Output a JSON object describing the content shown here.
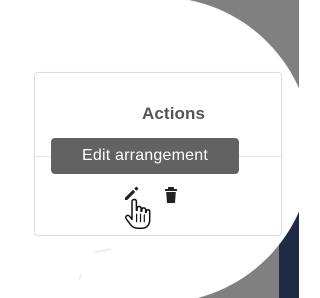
{
  "table": {
    "header": {
      "actions_label": "Actions"
    },
    "tooltip": {
      "label": "Edit arrangement"
    },
    "actions": {
      "edit_icon": "pencil-icon",
      "delete_icon": "trash-icon"
    }
  },
  "overlay": {
    "cursor_icon": "pointing-hand-cursor-icon"
  },
  "colors": {
    "card_border": "#d9dde3",
    "tooltip_background": "#626262",
    "tooltip_text": "#ffffff",
    "header_text": "#555555",
    "icon": "#222222",
    "outer_gray": "#808080",
    "outer_navy": "#1f2a44"
  }
}
